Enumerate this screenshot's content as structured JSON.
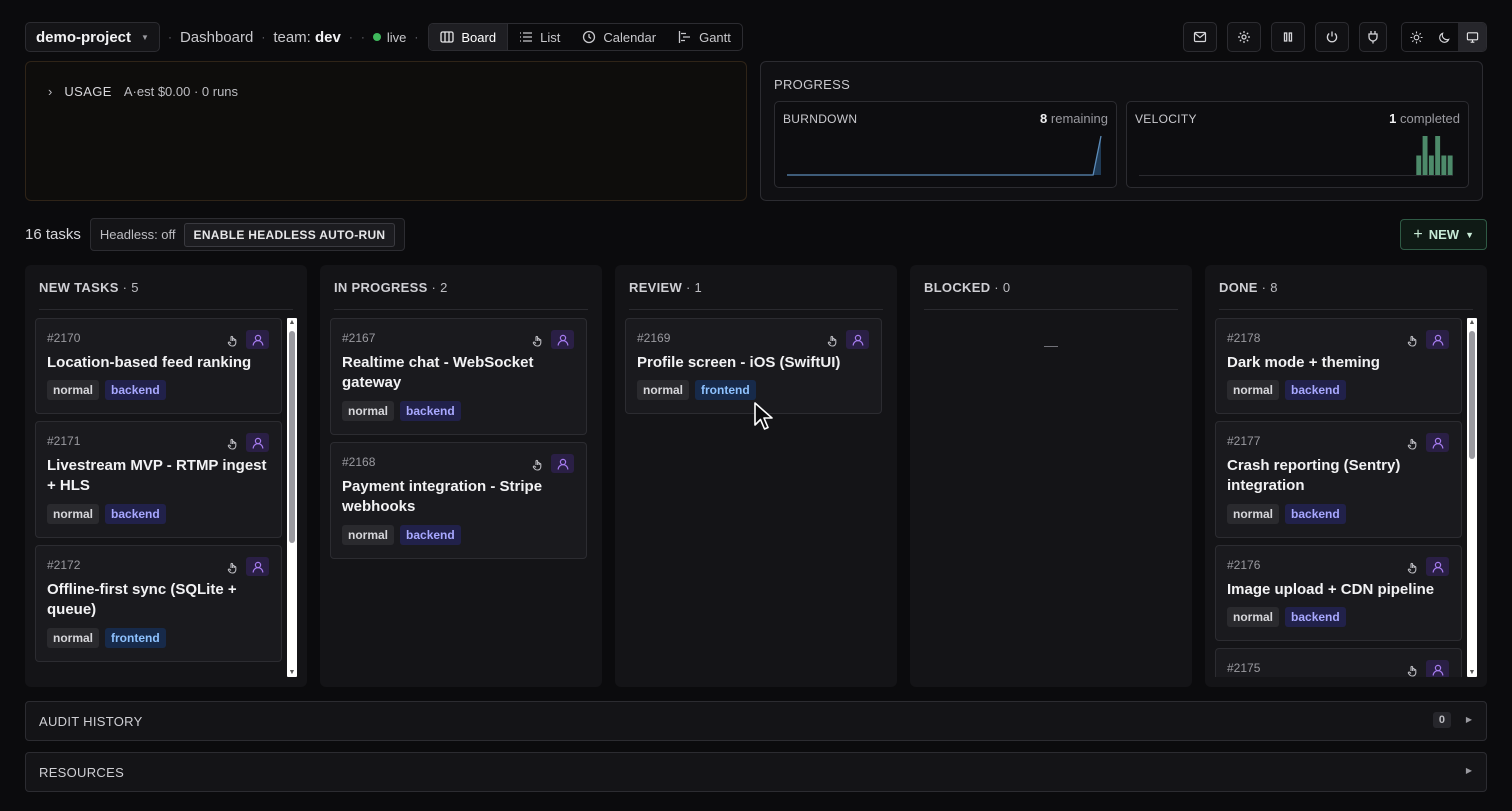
{
  "header": {
    "project": "demo-project",
    "crumbs": {
      "dashboard": "Dashboard",
      "team_label": "team:",
      "team_value": "dev",
      "status": "live"
    },
    "views": [
      {
        "label": "Board",
        "icon": "board-icon",
        "active": true
      },
      {
        "label": "List",
        "icon": "list-icon"
      },
      {
        "label": "Calendar",
        "icon": "clock-icon"
      },
      {
        "label": "Gantt",
        "icon": "gantt-icon"
      }
    ],
    "actions": [
      "mail-icon",
      "gear-icon",
      "pause-icon",
      "power-icon",
      "plug-icon"
    ],
    "theme": [
      "sun-icon",
      "moon-icon",
      "monitor-icon"
    ],
    "active_theme": "monitor"
  },
  "usage": {
    "label": "USAGE",
    "value": "A·est $0.00 · 0 runs"
  },
  "progress": {
    "title": "PROGRESS",
    "burndown": {
      "title": "BURNDOWN",
      "count": "8",
      "suffix": "remaining"
    },
    "velocity": {
      "title": "VELOCITY",
      "count": "1",
      "suffix": "completed"
    }
  },
  "chart_data": [
    {
      "type": "area",
      "title": "BURNDOWN",
      "values": [
        0,
        0,
        0,
        0,
        0,
        0,
        0,
        0,
        0,
        0,
        0,
        0,
        0,
        0,
        0,
        0,
        0,
        0,
        0,
        0,
        0,
        0,
        0,
        0,
        0,
        0,
        0,
        0,
        0,
        0,
        0,
        0,
        0,
        0,
        0,
        0,
        0,
        0,
        0,
        0,
        8
      ]
    },
    {
      "type": "bar",
      "title": "VELOCITY",
      "values": [
        0,
        0,
        0,
        0,
        0,
        0,
        0,
        0,
        0,
        0,
        0,
        0,
        0,
        0,
        0,
        0,
        0,
        0,
        0,
        0,
        0,
        0,
        0,
        0,
        0,
        0,
        0,
        0,
        0,
        0,
        0,
        0,
        0,
        0,
        0,
        0,
        0,
        0,
        0,
        0,
        0,
        0,
        0,
        0,
        2,
        4,
        2,
        4,
        2,
        2
      ],
      "colors": [
        "#4d8a6a"
      ]
    }
  ],
  "taskbar": {
    "count": "16 tasks",
    "headless_status": "Headless: off",
    "headless_button": "ENABLE HEADLESS AUTO-RUN",
    "new_button": "NEW"
  },
  "columns": [
    {
      "title": "NEW TASKS",
      "count": "5",
      "scroll": true,
      "cards": [
        {
          "id": "#2170",
          "title": "Location-based feed ranking",
          "priority": "normal",
          "area": "backend"
        },
        {
          "id": "#2171",
          "title": "Livestream MVP - RTMP ingest + HLS",
          "priority": "normal",
          "area": "backend"
        },
        {
          "id": "#2172",
          "title": "Offline-first sync (SQLite + queue)",
          "priority": "normal",
          "area": "frontend"
        }
      ]
    },
    {
      "title": "IN PROGRESS",
      "count": "2",
      "cards": [
        {
          "id": "#2167",
          "title": "Realtime chat - WebSocket gateway",
          "priority": "normal",
          "area": "backend"
        },
        {
          "id": "#2168",
          "title": "Payment integration - Stripe webhooks",
          "priority": "normal",
          "area": "backend"
        }
      ]
    },
    {
      "title": "REVIEW",
      "count": "1",
      "cards": [
        {
          "id": "#2169",
          "title": "Profile screen - iOS (SwiftUI)",
          "priority": "normal",
          "area": "frontend"
        }
      ]
    },
    {
      "title": "BLOCKED",
      "count": "0",
      "empty": "—",
      "cards": []
    },
    {
      "title": "DONE",
      "count": "8",
      "scroll": true,
      "cards": [
        {
          "id": "#2178",
          "title": "Dark mode + theming",
          "priority": "normal",
          "area": "backend"
        },
        {
          "id": "#2177",
          "title": "Crash reporting (Sentry) integration",
          "priority": "normal",
          "area": "backend"
        },
        {
          "id": "#2176",
          "title": "Image upload + CDN pipeline",
          "priority": "normal",
          "area": "backend"
        },
        {
          "id": "#2175",
          "title": "",
          "priority": "",
          "area": ""
        }
      ]
    }
  ],
  "sections": {
    "audit": {
      "title": "AUDIT HISTORY",
      "count": "0"
    },
    "resources": {
      "title": "RESOURCES"
    }
  }
}
